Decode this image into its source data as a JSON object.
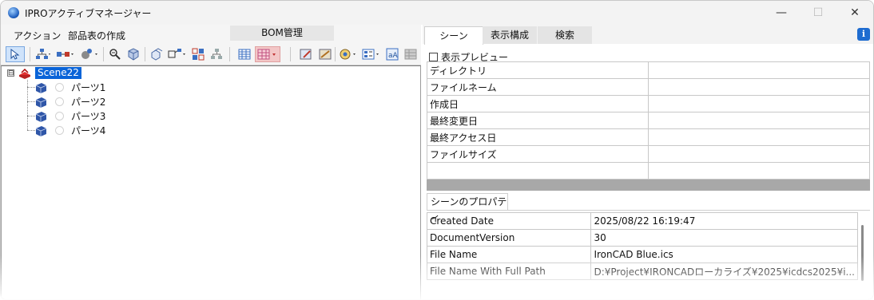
{
  "window": {
    "title": "IPROアクティブマネージャー",
    "minimize": "—",
    "maximize": "☐",
    "close": "✕"
  },
  "menu": {
    "items": [
      "アクション",
      "部品表の作成"
    ],
    "bom_tab": "BOM管理"
  },
  "toolbar": {
    "icons": [
      "select-icon",
      "hierarchy-icon",
      "link-icon",
      "configure-icon",
      "zoom-icon",
      "filter-icon",
      "duplicate-icon",
      "expand-icon",
      "swap-icon",
      "tree-icon",
      "table-icon",
      "highlight-icon",
      "edit-image-icon",
      "picture-icon",
      "color-icon",
      "view-icon",
      "text-icon",
      "grid-icon"
    ]
  },
  "tree": {
    "root": {
      "label": "Scene22",
      "expander": "⊟"
    },
    "parts": [
      "パーツ1",
      "パーツ2",
      "パーツ3",
      "パーツ4"
    ]
  },
  "right": {
    "tabs": [
      "シーン",
      "表示構成",
      "検索"
    ],
    "active_tab": "シーン",
    "info": "i",
    "preview_label": "表示プレビュー",
    "info_rows": [
      {
        "label": "ディレクトリ",
        "value": ""
      },
      {
        "label": "ファイルネーム",
        "value": ""
      },
      {
        "label": "作成日",
        "value": ""
      },
      {
        "label": "最終変更日",
        "value": ""
      },
      {
        "label": "最終アクセス日",
        "value": ""
      },
      {
        "label": "ファイルサイズ",
        "value": ""
      },
      {
        "label": "",
        "value": ""
      }
    ],
    "props_tab": "シーンのプロパティ",
    "props_rows": [
      {
        "name": "Created Date",
        "value": "2025/08/22 16:19:47"
      },
      {
        "name": "DocumentVersion",
        "value": "30"
      },
      {
        "name": "File Name",
        "value": "IronCAD Blue.ics"
      },
      {
        "name": "File Name With Full Path",
        "value": "D:¥Project¥IRONCADローカライズ¥2025¥icdcs2025¥i..."
      }
    ]
  }
}
